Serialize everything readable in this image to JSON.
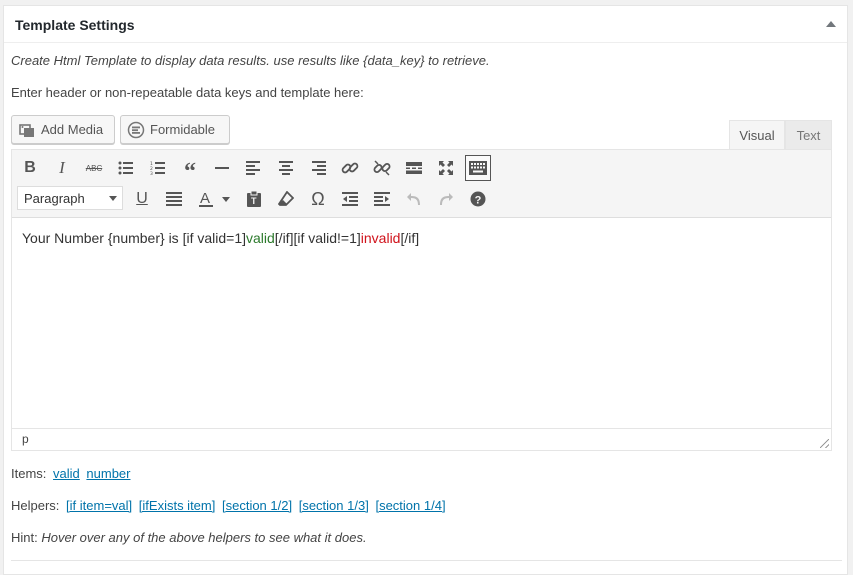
{
  "panel": {
    "title": "Template Settings",
    "description": "Create Html Template to display data results. use results like {data_key} to retrieve.",
    "instruction": "Enter header or non-repeatable data keys and template here:"
  },
  "media_buttons": {
    "add_media": "Add Media",
    "formidable": "Formidable"
  },
  "editor_tabs": {
    "visual": "Visual",
    "text": "Text"
  },
  "toolbar": {
    "format_select": "Paragraph",
    "icons_row1": [
      "bold-icon",
      "italic-icon",
      "strikethrough-icon",
      "bullet-list-icon",
      "numbered-list-icon",
      "blockquote-icon",
      "horizontal-rule-icon",
      "align-left-icon",
      "align-center-icon",
      "align-right-icon",
      "insert-link-icon",
      "remove-link-icon",
      "read-more-icon",
      "fullscreen-icon",
      "toolbar-toggle-icon"
    ],
    "icons_row2": [
      "underline-icon",
      "justify-icon",
      "text-color-icon",
      "paste-as-text-icon",
      "clear-formatting-icon",
      "special-character-icon",
      "outdent-icon",
      "indent-icon",
      "undo-icon",
      "redo-icon",
      "help-icon"
    ]
  },
  "content": {
    "part1": "Your Number {number} is [if valid=1]",
    "valid_word": "valid",
    "part2": "[/if][if valid!=1]",
    "invalid_word": "invalid",
    "part3": "[/if]"
  },
  "status_bar": {
    "path": "p"
  },
  "items": {
    "label": "Items:",
    "links": [
      "valid",
      "number"
    ]
  },
  "helpers": {
    "label": "Helpers:",
    "links": [
      "[if item=val]",
      "[ifExists item]",
      "[section 1/2]",
      "[section 1/3]",
      "[section 1/4]"
    ]
  },
  "hint": {
    "label": "Hint:",
    "text": "Hover over any of the above helpers to see what it does."
  },
  "colors": {
    "valid": "#2c7a2c",
    "invalid": "#d0121b",
    "link": "#0073aa"
  }
}
